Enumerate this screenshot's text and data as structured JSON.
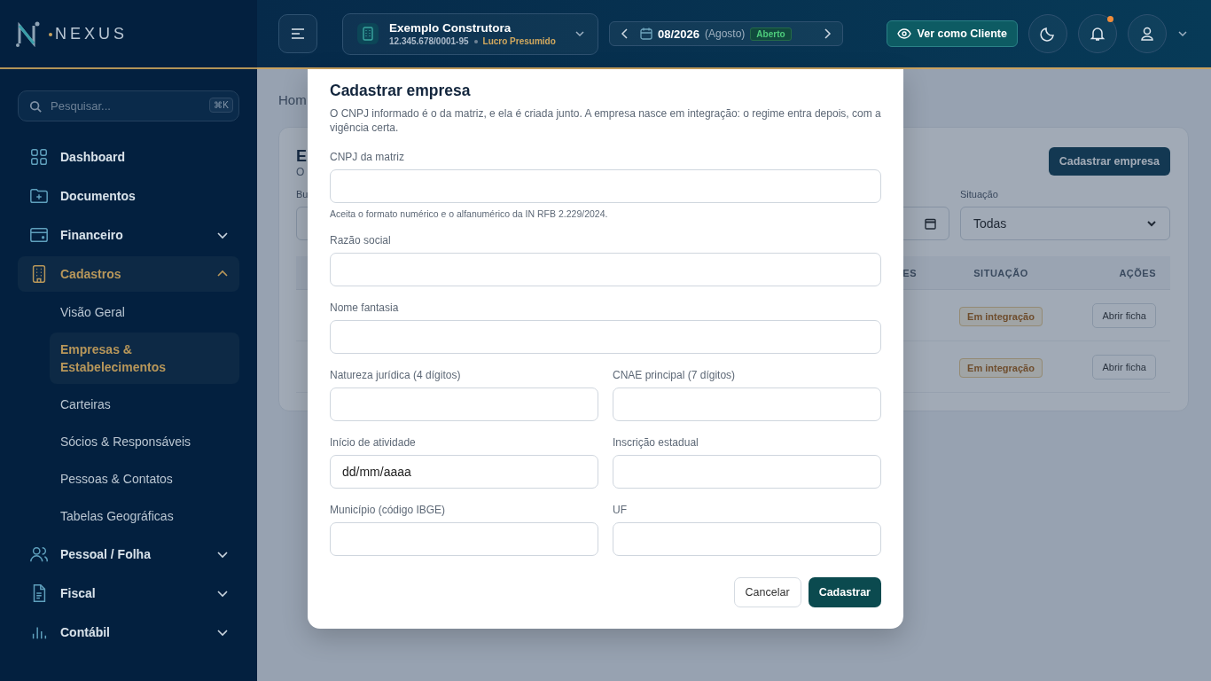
{
  "brand": {
    "name": "NEXUS"
  },
  "sidebar": {
    "search": {
      "placeholder": "Pesquisar...",
      "shortcut": "⌘K"
    },
    "items": [
      {
        "label": "Dashboard",
        "kind": "link",
        "selected": false
      },
      {
        "label": "Documentos",
        "kind": "link",
        "selected": false
      },
      {
        "label": "Financeiro",
        "kind": "group",
        "selected": false,
        "expanded": false
      },
      {
        "label": "Cadastros",
        "kind": "group",
        "selected": true,
        "expanded": true,
        "children": [
          {
            "label": "Visão Geral",
            "selected": false
          },
          {
            "label": "Empresas & Estabelecimentos",
            "selected": true
          },
          {
            "label": "Carteiras",
            "selected": false
          },
          {
            "label": "Sócios & Responsáveis",
            "selected": false
          },
          {
            "label": "Pessoas & Contatos",
            "selected": false
          },
          {
            "label": "Tabelas Geográficas",
            "selected": false
          }
        ]
      },
      {
        "label": "Pessoal / Folha",
        "kind": "group",
        "selected": false,
        "expanded": false
      },
      {
        "label": "Fiscal",
        "kind": "group",
        "selected": false,
        "expanded": false
      },
      {
        "label": "Contábil",
        "kind": "group",
        "selected": false,
        "expanded": false
      }
    ]
  },
  "header": {
    "company": {
      "name": "Exemplo Construtora",
      "cnpj": "12.345.678/0001-95",
      "regime": "Lucro Presumido"
    },
    "period": {
      "value": "08/2026",
      "month": "(Agosto)",
      "status": "Aberto"
    },
    "client_view_button": "Ver como Cliente",
    "notifications": {
      "unread": true
    }
  },
  "page": {
    "breadcrumb": "Hom",
    "card": {
      "title": "E",
      "subtitle": "O",
      "add_button": "Cadastrar empresa",
      "filters": [
        {
          "kind": "text",
          "label": "Bu"
        },
        {
          "kind": "date"
        },
        {
          "kind": "select",
          "label": "Situação",
          "value": "Todas"
        }
      ],
      "table": {
        "columns": [
          "ES",
          "SITUAÇÃO",
          "AÇÕES"
        ],
        "rows": [
          {
            "status": "Em integração",
            "action": "Abrir ficha"
          },
          {
            "status": "Em integração",
            "action": "Abrir ficha"
          }
        ]
      }
    }
  },
  "modal": {
    "title": "Cadastrar empresa",
    "description": "O CNPJ informado é o da matriz, e ela é criada junto. A empresa nasce em integração: o regime entra depois, com a vigência certa.",
    "fields": [
      {
        "label": "CNPJ da matriz",
        "kind": "full",
        "hint": "Aceita o formato numérico e o alfanumérico da IN RFB 2.229/2024."
      },
      {
        "label": "Razão social",
        "kind": "full"
      },
      {
        "label": "Nome fantasia",
        "kind": "full"
      },
      {
        "label": "Natureza jurídica (4 dígitos)",
        "kind": "half"
      },
      {
        "label": "CNAE principal (7 dígitos)",
        "kind": "half"
      },
      {
        "label": "Início de atividade",
        "kind": "half",
        "placeholder": "dd/mm/aaaa"
      },
      {
        "label": "Inscrição estadual",
        "kind": "half"
      },
      {
        "label": "Município (código IBGE)",
        "kind": "half"
      },
      {
        "label": "UF",
        "kind": "half"
      }
    ],
    "buttons": [
      {
        "label": "Cancelar",
        "kind": "secondary"
      },
      {
        "label": "Cadastrar",
        "kind": "primary"
      }
    ]
  }
}
